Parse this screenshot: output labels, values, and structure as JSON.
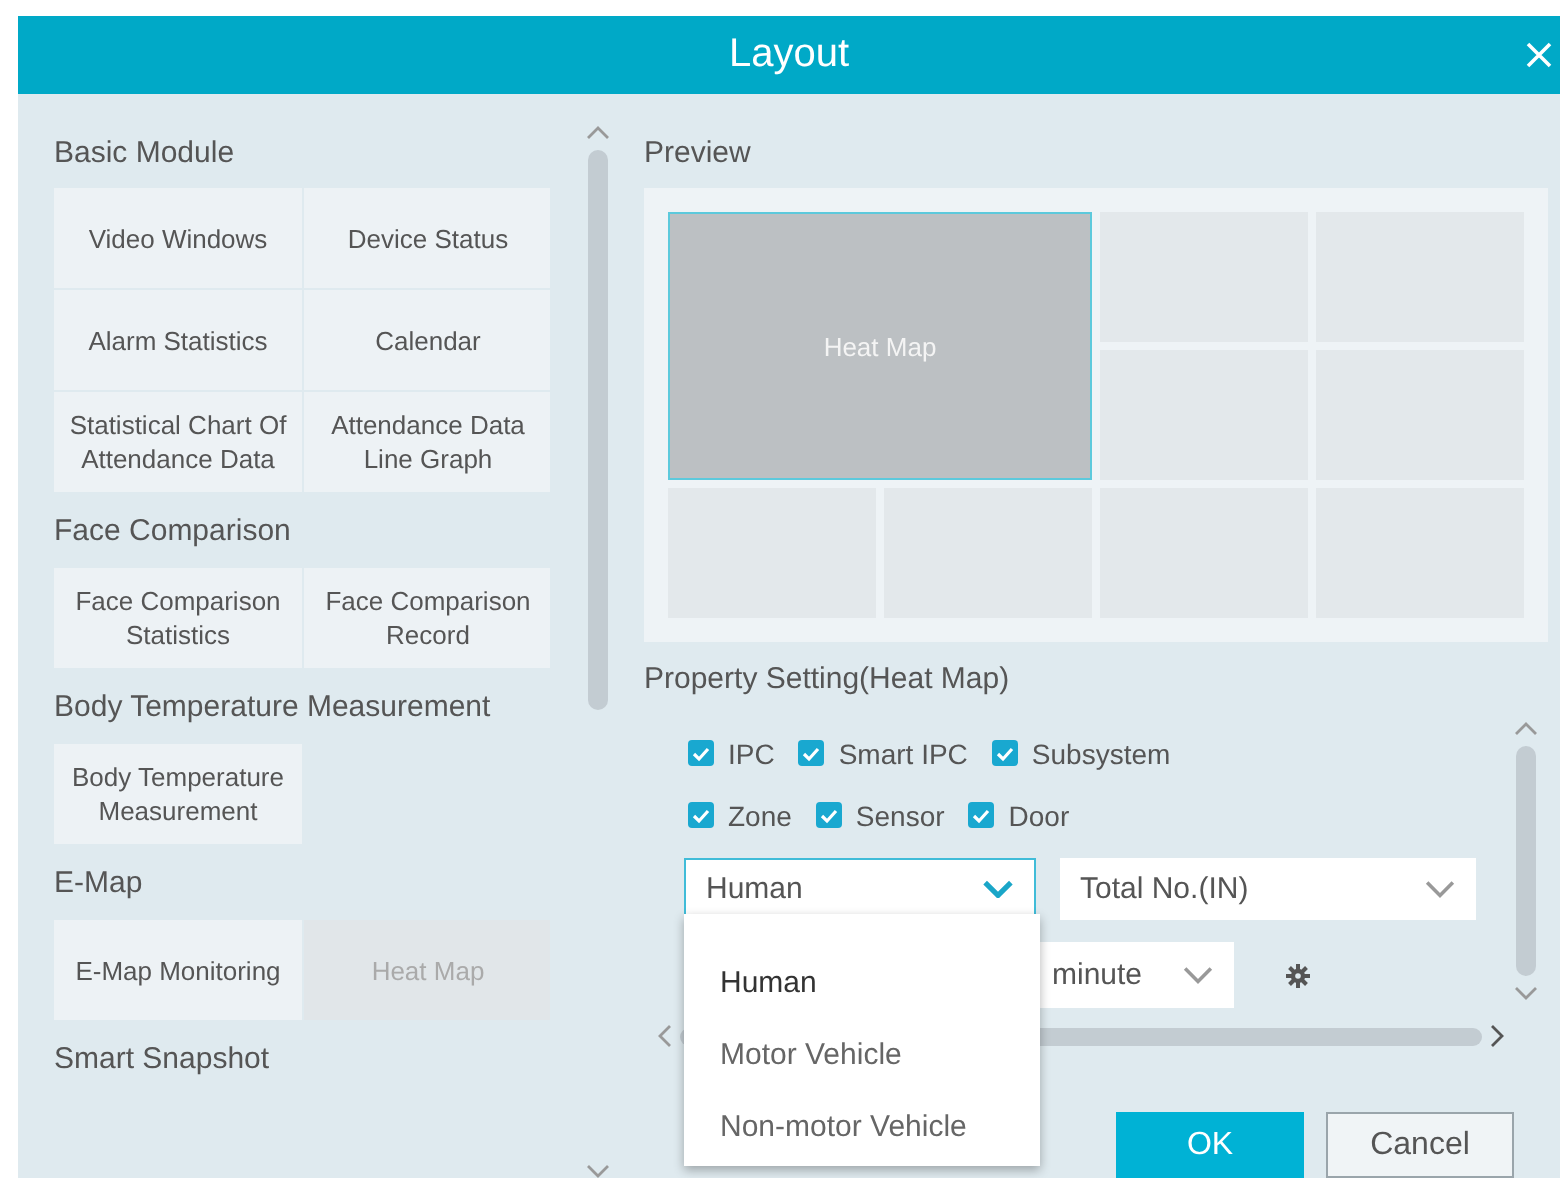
{
  "window": {
    "title": "Layout"
  },
  "modules": [
    {
      "title": "Basic Module",
      "items": [
        {
          "label": "Video Windows",
          "disabled": false
        },
        {
          "label": "Device Status",
          "disabled": false
        },
        {
          "label": "Alarm Statistics",
          "disabled": false
        },
        {
          "label": "Calendar",
          "disabled": false
        },
        {
          "label": "Statistical Chart Of Attendance Data",
          "disabled": false
        },
        {
          "label": "Attendance Data Line Graph",
          "disabled": false
        }
      ]
    },
    {
      "title": "Face Comparison",
      "items": [
        {
          "label": "Face Comparison Statistics",
          "disabled": false
        },
        {
          "label": "Face Comparison Record",
          "disabled": false
        }
      ]
    },
    {
      "title": "Body Temperature Measurement",
      "items": [
        {
          "label": "Body Temperature Measurement",
          "disabled": false
        }
      ]
    },
    {
      "title": "E-Map",
      "items": [
        {
          "label": "E-Map Monitoring",
          "disabled": false
        },
        {
          "label": "Heat Map",
          "disabled": true
        }
      ]
    },
    {
      "title": "Smart Snapshot"
    }
  ],
  "preview": {
    "title": "Preview",
    "cells": [
      {
        "label": "Heat Map",
        "selected": true
      },
      {
        "selected": false
      },
      {
        "selected": false
      },
      {
        "selected": false
      },
      {
        "selected": false
      },
      {
        "selected": false
      },
      {
        "selected": false
      },
      {
        "selected": false
      },
      {
        "selected": false
      }
    ]
  },
  "property": {
    "title": "Property Setting(Heat Map)",
    "checkbox_rows": [
      [
        {
          "label": "IPC",
          "checked": true
        },
        {
          "label": "Smart IPC",
          "checked": true
        },
        {
          "label": "Subsystem",
          "checked": true
        }
      ],
      [
        {
          "label": "Zone",
          "checked": true
        },
        {
          "label": "Sensor",
          "checked": true
        },
        {
          "label": "Door",
          "checked": true
        }
      ]
    ],
    "selects": [
      {
        "value": "Human",
        "focused": true
      },
      {
        "value": "Total No.(IN)",
        "focused": false
      }
    ],
    "interval": {
      "value": "minute"
    },
    "dropdown": {
      "options": [
        {
          "label": "Human",
          "selected": true
        },
        {
          "label": "Motor Vehicle",
          "selected": false
        },
        {
          "label": "Non-motor Vehicle",
          "selected": false
        }
      ]
    }
  },
  "buttons": [
    {
      "label": "OK",
      "kind": "primary"
    },
    {
      "label": "Cancel",
      "kind": "secondary"
    }
  ]
}
